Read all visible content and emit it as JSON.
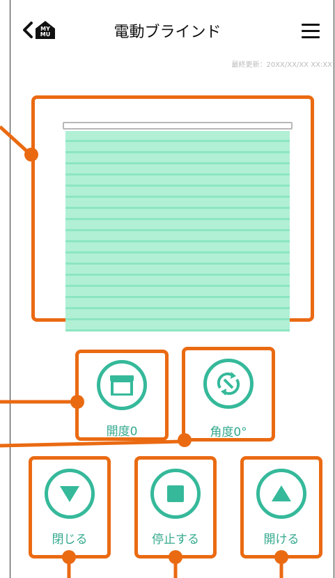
{
  "header": {
    "back_icon": "chevron-left-icon",
    "logo_text": "MY\nMU",
    "title": "電動ブラインド",
    "menu_icon": "hamburger-menu-icon",
    "last_updated": "最終更新：20XX/XX/XX XX:XX"
  },
  "status": {
    "opening": "開度0",
    "angle": "角度0°"
  },
  "controls": {
    "close": "閉じる",
    "stop": "停止する",
    "open": "開ける"
  },
  "colors": {
    "accent": "#ea6a12",
    "teal": "#35b99a",
    "slat": "#b1f0d5"
  }
}
